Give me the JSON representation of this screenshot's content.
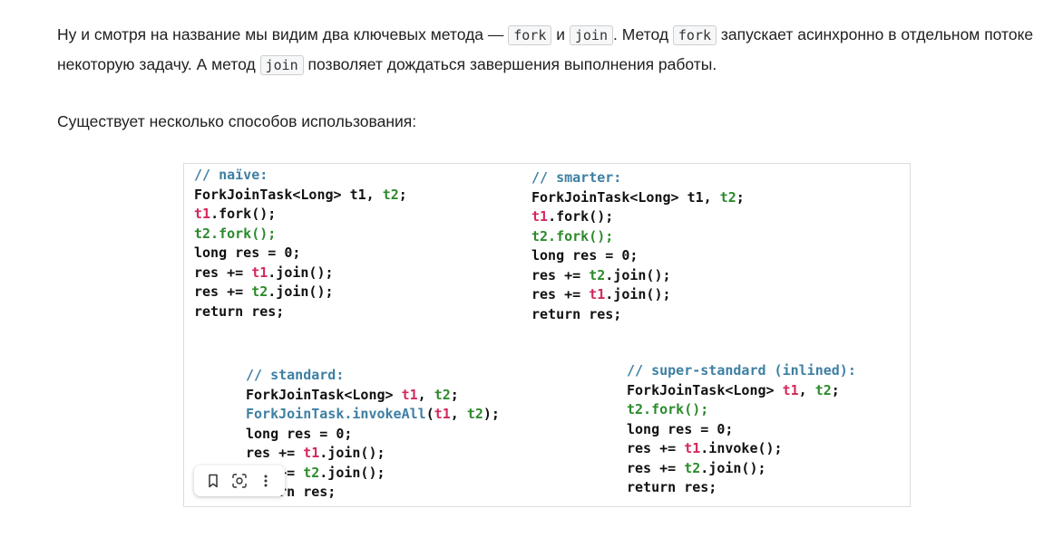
{
  "paragraph1": {
    "t1": "Ну и смотря на название мы видим два ключевых метода — ",
    "c1": "fork",
    "t2": " и ",
    "c2": "join",
    "t3": ". Метод ",
    "c3": "fork",
    "t4": " запускает асинхронно в отдельном потоке некоторую задачу. А метод ",
    "c4": "join",
    "t5": " позволяет дождаться завершения выполнения работы."
  },
  "paragraph2": "Существует несколько способов использования:",
  "figure": {
    "naive": {
      "comment": "// naïve:",
      "l1a": "ForkJoinTask<Long> t1, ",
      "l1b": "t2",
      "l1c": ";",
      "l2a": "t1",
      "l2b": ".fork();",
      "l3a": "t2.fork();",
      "l4": "long res = 0;",
      "l5a": "res += ",
      "l5b": "t1",
      "l5c": ".join();",
      "l6a": "res += ",
      "l6b": "t2",
      "l6c": ".join();",
      "l7": "return res;"
    },
    "smarter": {
      "comment": "// smarter:",
      "l1a": "ForkJoinTask<Long> t1, ",
      "l1b": "t2",
      "l1c": ";",
      "l2a": "t1",
      "l2b": ".fork();",
      "l3a": "t2.fork();",
      "l4": "long res = 0;",
      "l5a": "res += ",
      "l5b": "t2",
      "l5c": ".join();",
      "l6a": "res += ",
      "l6b": "t1",
      "l6c": ".join();",
      "l7": "return res;"
    },
    "standard": {
      "comment": "// standard:",
      "l1a": "ForkJoinTask<Long> ",
      "l1b": "t1",
      "l1c": ", ",
      "l1d": "t2",
      "l1e": ";",
      "l2a": "ForkJoinTask.invokeAll",
      "l2b": "(",
      "l2c": "t1",
      "l2d": ", ",
      "l2e": "t2",
      "l2f": ");",
      "l3": "long res = 0;",
      "l4a": "res += ",
      "l4b": "t1",
      "l4c": ".join();",
      "l5a": "res += ",
      "l5b": "t2",
      "l5c": ".join();",
      "l6": "return res;"
    },
    "super": {
      "comment": "// super-standard (inlined):",
      "l1a": "ForkJoinTask<Long> ",
      "l1b": "t1",
      "l1c": ", ",
      "l1d": "t2",
      "l1e": ";",
      "l2a": "t2.fork();",
      "l3": "long res = 0;",
      "l4a": "res += ",
      "l4b": "t1",
      "l4c": ".invoke();",
      "l5a": "res += ",
      "l5b": "t2",
      "l5c": ".join();",
      "l6": "return res;"
    }
  },
  "image_toolbar": {
    "icons": [
      "bookmark-icon",
      "lens-icon",
      "more-vertical-icon"
    ]
  },
  "colors": {
    "comment": "#3d7fa3",
    "t1": "#d4285a",
    "t2": "#2d8a2d"
  }
}
